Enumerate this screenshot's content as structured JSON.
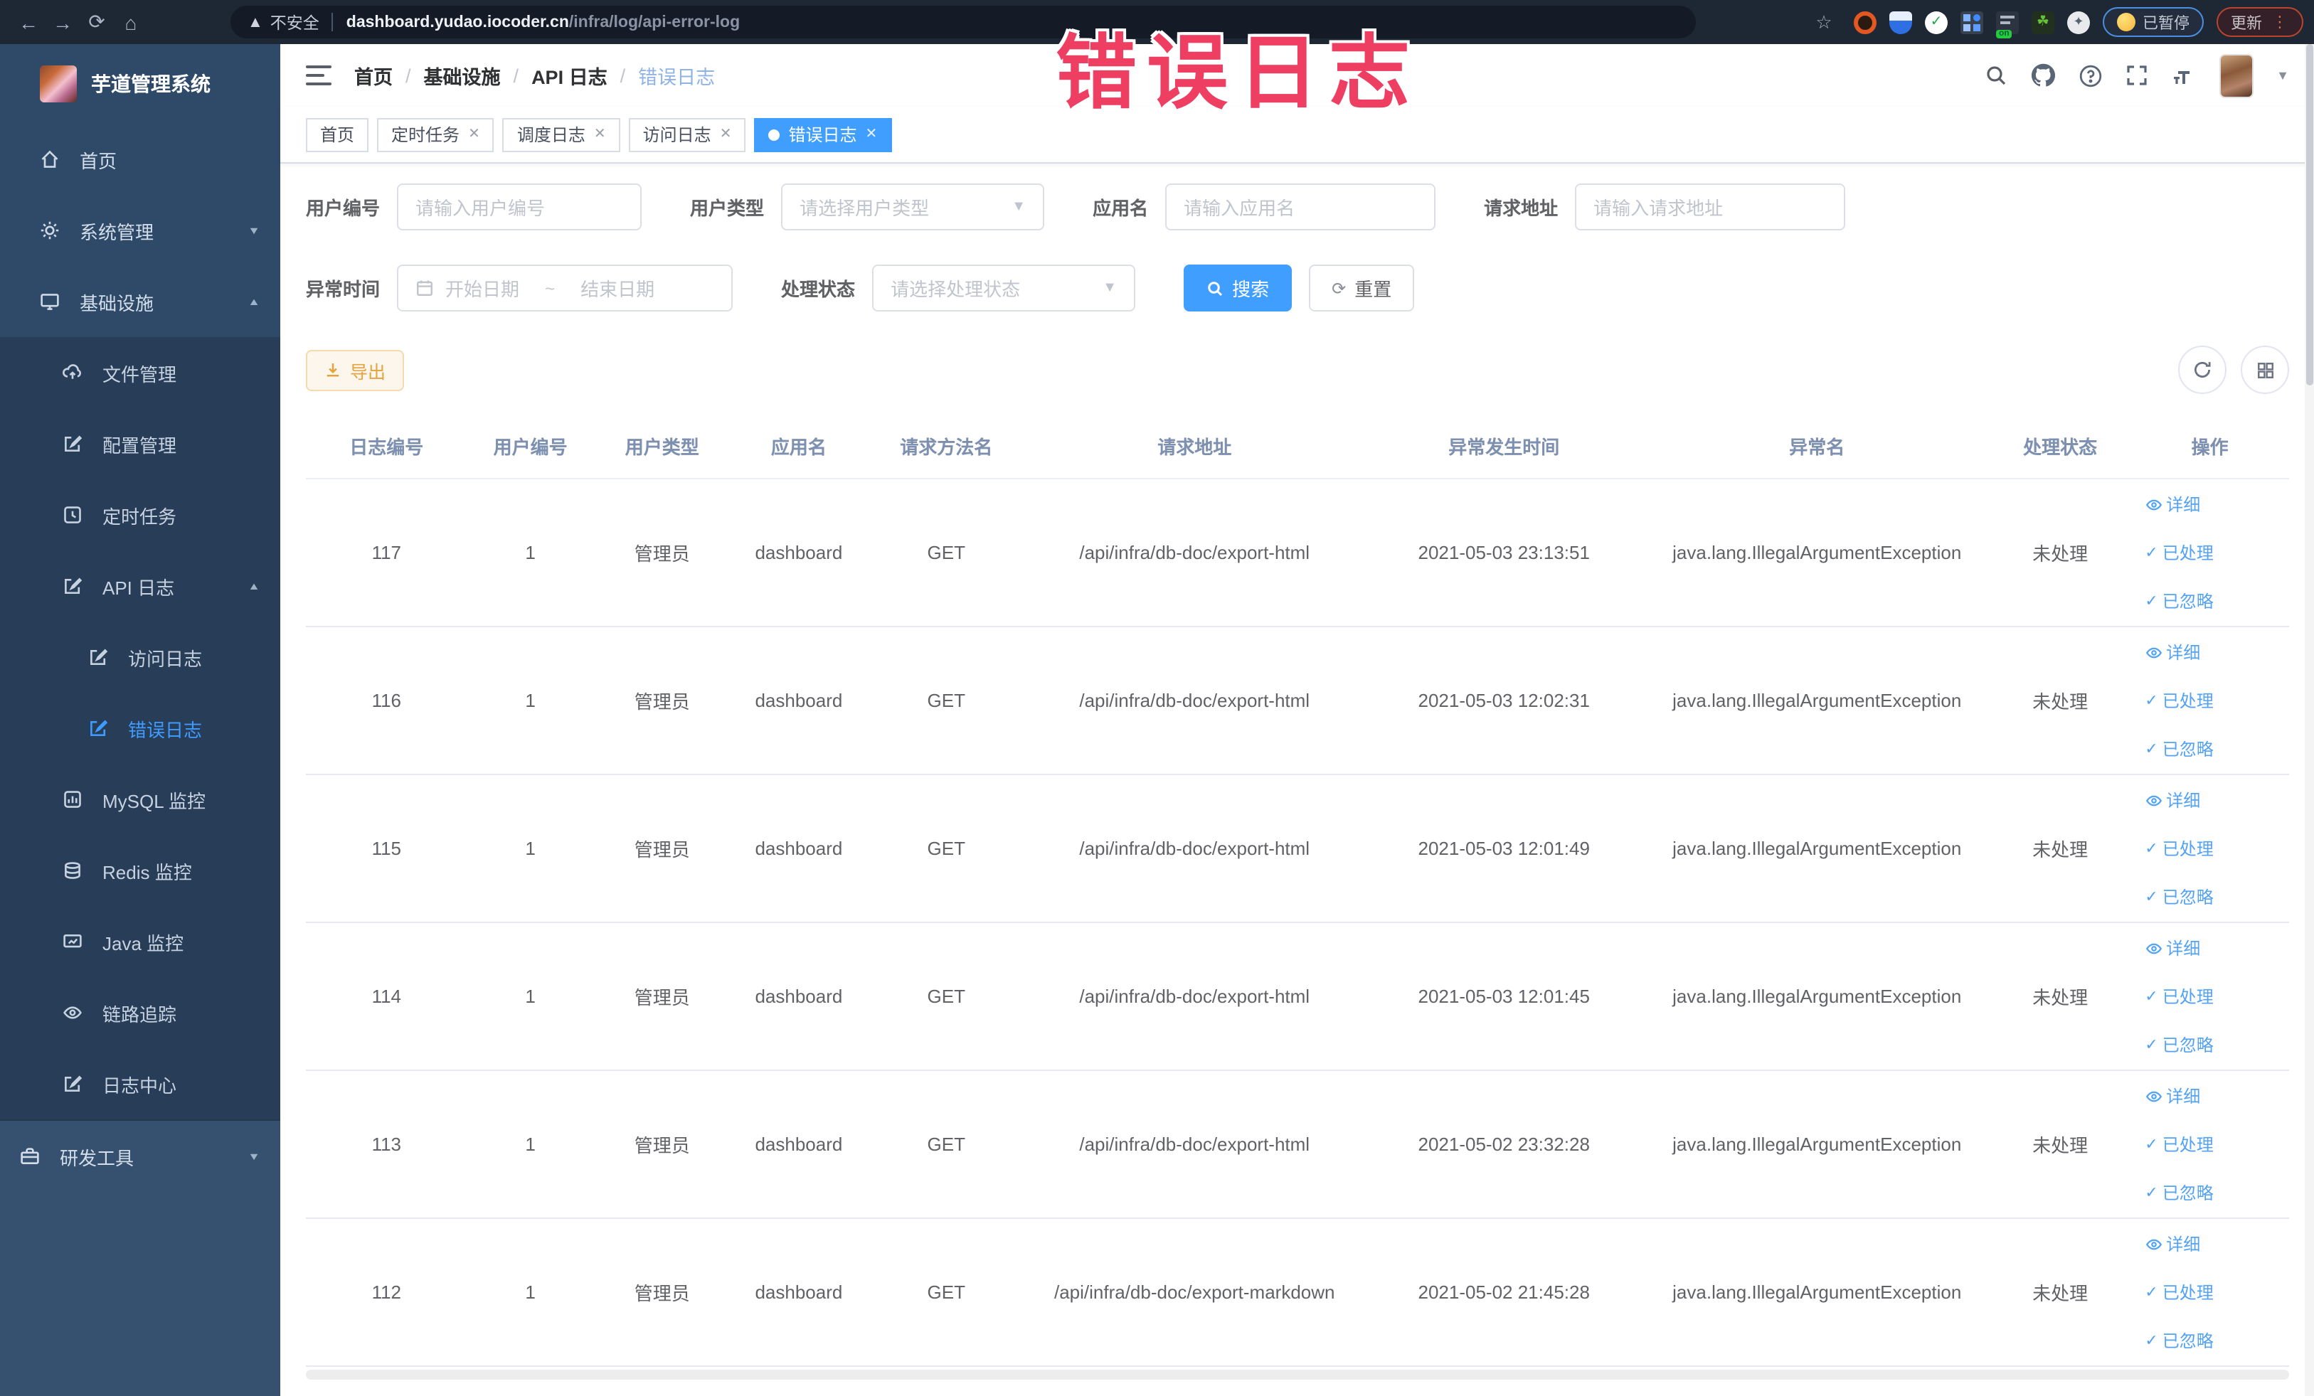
{
  "colors": {
    "accent": "#409eff",
    "warning": "#e6a23c",
    "overlay_pink": "#ee3e62",
    "sidebar_bg": "#2e4a68",
    "chrome_bg": "#1e2734"
  },
  "overlay": {
    "text": "错误日志"
  },
  "browser": {
    "security_label": "不安全",
    "url_domain": "dashboard.yudao.iocoder.cn",
    "url_path": "/infra/log/api-error-log",
    "paused_badge": "已暂停",
    "update_button": "更新"
  },
  "sidebar": {
    "title": "芋道管理系统",
    "items": [
      {
        "label": "首页"
      },
      {
        "label": "系统管理"
      },
      {
        "label": "基础设施"
      },
      {
        "label": "文件管理"
      },
      {
        "label": "配置管理"
      },
      {
        "label": "定时任务"
      },
      {
        "label": "API 日志"
      },
      {
        "label": "访问日志"
      },
      {
        "label": "错误日志"
      },
      {
        "label": "MySQL 监控"
      },
      {
        "label": "Redis 监控"
      },
      {
        "label": "Java 监控"
      },
      {
        "label": "链路追踪"
      },
      {
        "label": "日志中心"
      },
      {
        "label": "研发工具"
      }
    ]
  },
  "breadcrumb": {
    "items": [
      "首页",
      "基础设施",
      "API 日志",
      "错误日志"
    ],
    "separator": "/"
  },
  "tabs": [
    {
      "label": "首页"
    },
    {
      "label": "定时任务"
    },
    {
      "label": "调度日志"
    },
    {
      "label": "访问日志"
    },
    {
      "label": "错误日志"
    }
  ],
  "filters": {
    "user_id": {
      "label": "用户编号",
      "placeholder": "请输入用户编号"
    },
    "user_type": {
      "label": "用户类型",
      "placeholder": "请选择用户类型"
    },
    "app_name": {
      "label": "应用名",
      "placeholder": "请输入应用名"
    },
    "request_url": {
      "label": "请求地址",
      "placeholder": "请输入请求地址"
    },
    "exception_time": {
      "label": "异常时间",
      "start_placeholder": "开始日期",
      "separator": "~",
      "end_placeholder": "结束日期"
    },
    "process_status": {
      "label": "处理状态",
      "placeholder": "请选择处理状态"
    },
    "search_button": "搜索",
    "reset_button": "重置"
  },
  "toolbar": {
    "export_button": "导出"
  },
  "table": {
    "columns": [
      "日志编号",
      "用户编号",
      "用户类型",
      "应用名",
      "请求方法名",
      "请求地址",
      "异常发生时间",
      "异常名",
      "处理状态",
      "操作"
    ],
    "ops": [
      "详细",
      "已处理",
      "已忽略"
    ],
    "rows": [
      {
        "id": "117",
        "user_id": "1",
        "user_type": "管理员",
        "app_name": "dashboard",
        "method": "GET",
        "url": "/api/infra/db-doc/export-html",
        "time": "2021-05-03 23:13:51",
        "exception": "java.lang.IllegalArgumentException",
        "status": "未处理"
      },
      {
        "id": "116",
        "user_id": "1",
        "user_type": "管理员",
        "app_name": "dashboard",
        "method": "GET",
        "url": "/api/infra/db-doc/export-html",
        "time": "2021-05-03 12:02:31",
        "exception": "java.lang.IllegalArgumentException",
        "status": "未处理"
      },
      {
        "id": "115",
        "user_id": "1",
        "user_type": "管理员",
        "app_name": "dashboard",
        "method": "GET",
        "url": "/api/infra/db-doc/export-html",
        "time": "2021-05-03 12:01:49",
        "exception": "java.lang.IllegalArgumentException",
        "status": "未处理"
      },
      {
        "id": "114",
        "user_id": "1",
        "user_type": "管理员",
        "app_name": "dashboard",
        "method": "GET",
        "url": "/api/infra/db-doc/export-html",
        "time": "2021-05-03 12:01:45",
        "exception": "java.lang.IllegalArgumentException",
        "status": "未处理"
      },
      {
        "id": "113",
        "user_id": "1",
        "user_type": "管理员",
        "app_name": "dashboard",
        "method": "GET",
        "url": "/api/infra/db-doc/export-html",
        "time": "2021-05-02 23:32:28",
        "exception": "java.lang.IllegalArgumentException",
        "status": "未处理"
      },
      {
        "id": "112",
        "user_id": "1",
        "user_type": "管理员",
        "app_name": "dashboard",
        "method": "GET",
        "url": "/api/infra/db-doc/export-markdown",
        "time": "2021-05-02 21:45:28",
        "exception": "java.lang.IllegalArgumentException",
        "status": "未处理"
      }
    ]
  }
}
